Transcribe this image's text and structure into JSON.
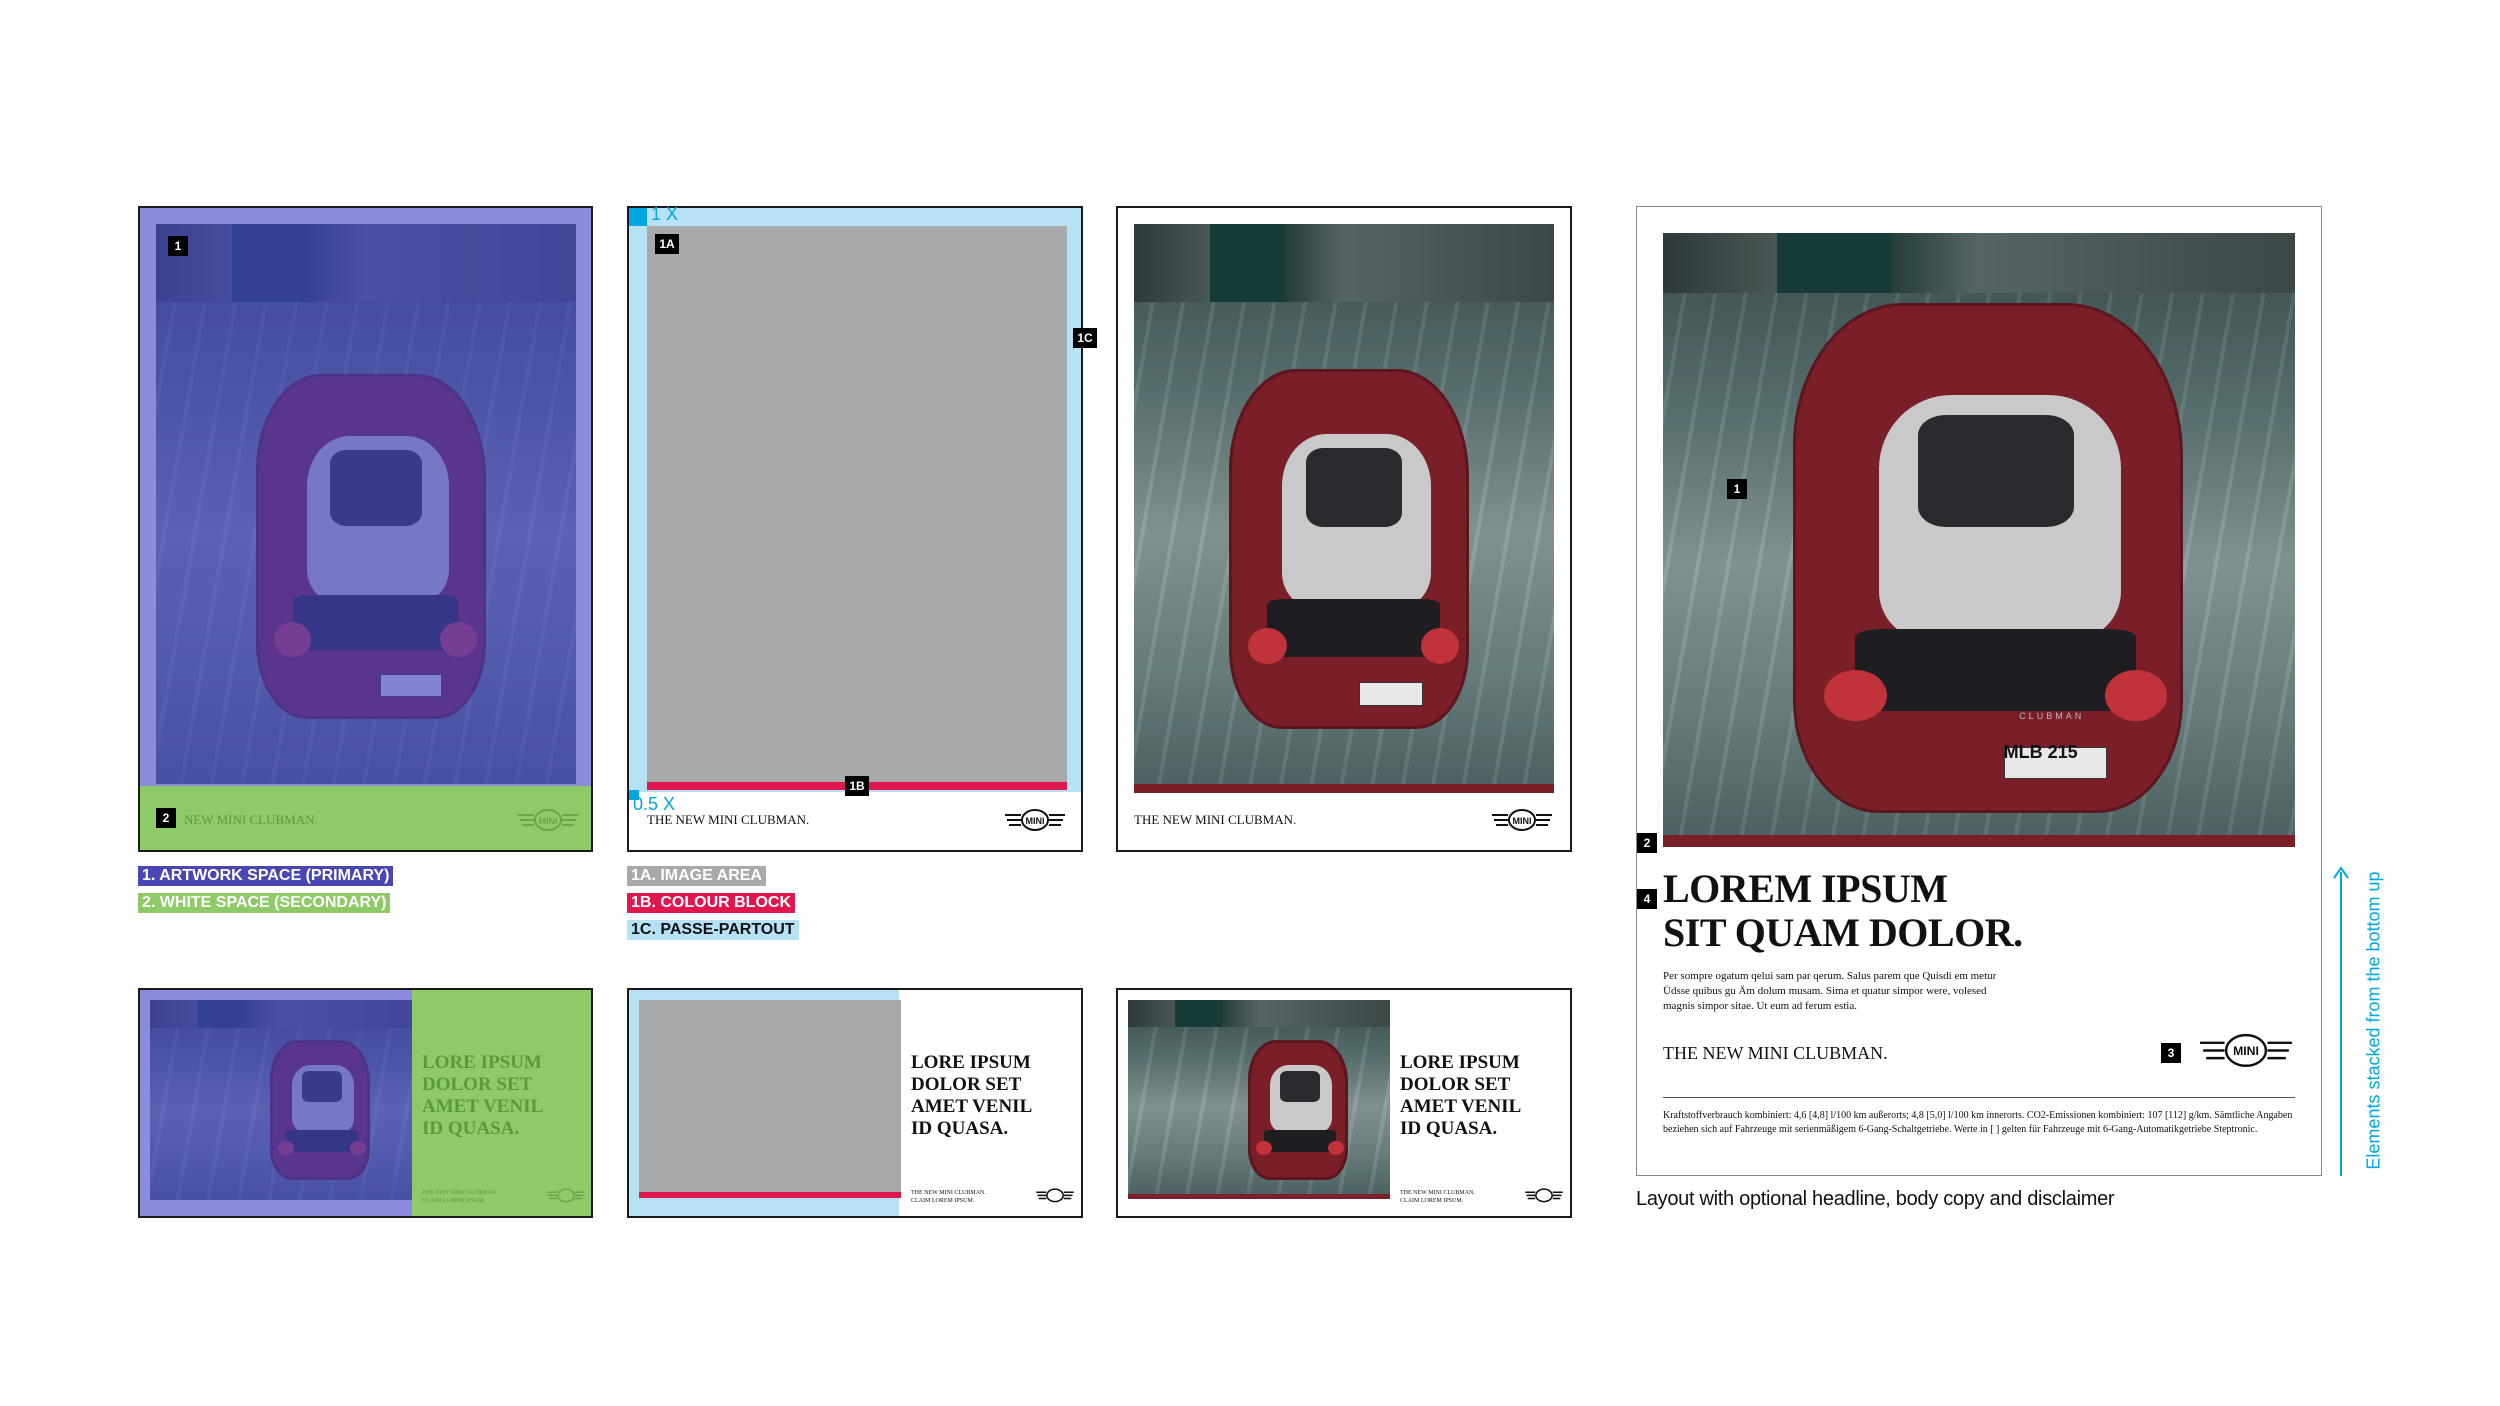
{
  "brand": {
    "accent_purple": "#4a46b4",
    "accent_green": "#8ecb68",
    "accent_light_blue": "#b7e2f6",
    "accent_cyan": "#00a7e0",
    "accent_red": "#e0174f",
    "accent_grey": "#a8a9ab",
    "bar_dark_red": "#7a1e28"
  },
  "labels": {
    "n1": "1",
    "n2": "2",
    "n3": "3",
    "n4": "4",
    "n1a": "1A",
    "n1b": "1B",
    "n1c": "1C",
    "one_x": "1 X",
    "half_x": "0.5 X"
  },
  "legend": {
    "artwork": "1. ARTWORK SPACE (PRIMARY)",
    "white_space": "2. WHITE SPACE (SECONDARY)",
    "image_area": "1A. IMAGE AREA",
    "colour_block": "1B. COLOUR BLOCK",
    "passe_partout": "1C. PASSE-PARTOUT"
  },
  "copy": {
    "tagline": "THE NEW MINI CLUBMAN.",
    "tagline_green": "NEW MINI CLUBMAN.",
    "claim": "CLAIM LOREM IPSUM.",
    "small_headline_l1": "LORE IPSUM",
    "small_headline_l2": "DOLOR SET",
    "small_headline_l3": "AMET VENIL",
    "small_headline_l4": "ID QUASA.",
    "logo_text": "MINI",
    "big_headline_l1": "LOREM IPSUM",
    "big_headline_l2": "SIT QUAM DOLOR.",
    "body": "Per sompre ogatum qelui sam par qerum. Salus parem que Quisdi em metur Üdsse quibus gu Äm dolum musam. Sima et quatur simpor were, volesed magnis simpor sitae. Ut eum ad ferum estia.",
    "disclaimer": "Kraftstoffverbrauch kombiniert: 4,6 [4,8] l/100 km außerorts; 4,8 [5,0] l/100 km innerorts. CO2-Emissionen kombiniert: 107 [112] g/km. Sämtliche Angaben beziehen sich auf Fahrzeuge mit serienmäßigem 6-Gang-Schaltgetriebe. Werte in [ ] gelten für Fahrzeuge mit 6-Gang-Automatikgetriebe Steptronic.",
    "caption": "Layout with optional headline, body copy and disclaimer",
    "side_note": "Elements stacked from the bottom up",
    "plate": "MLB 215",
    "badge": "CLUBMAN"
  }
}
